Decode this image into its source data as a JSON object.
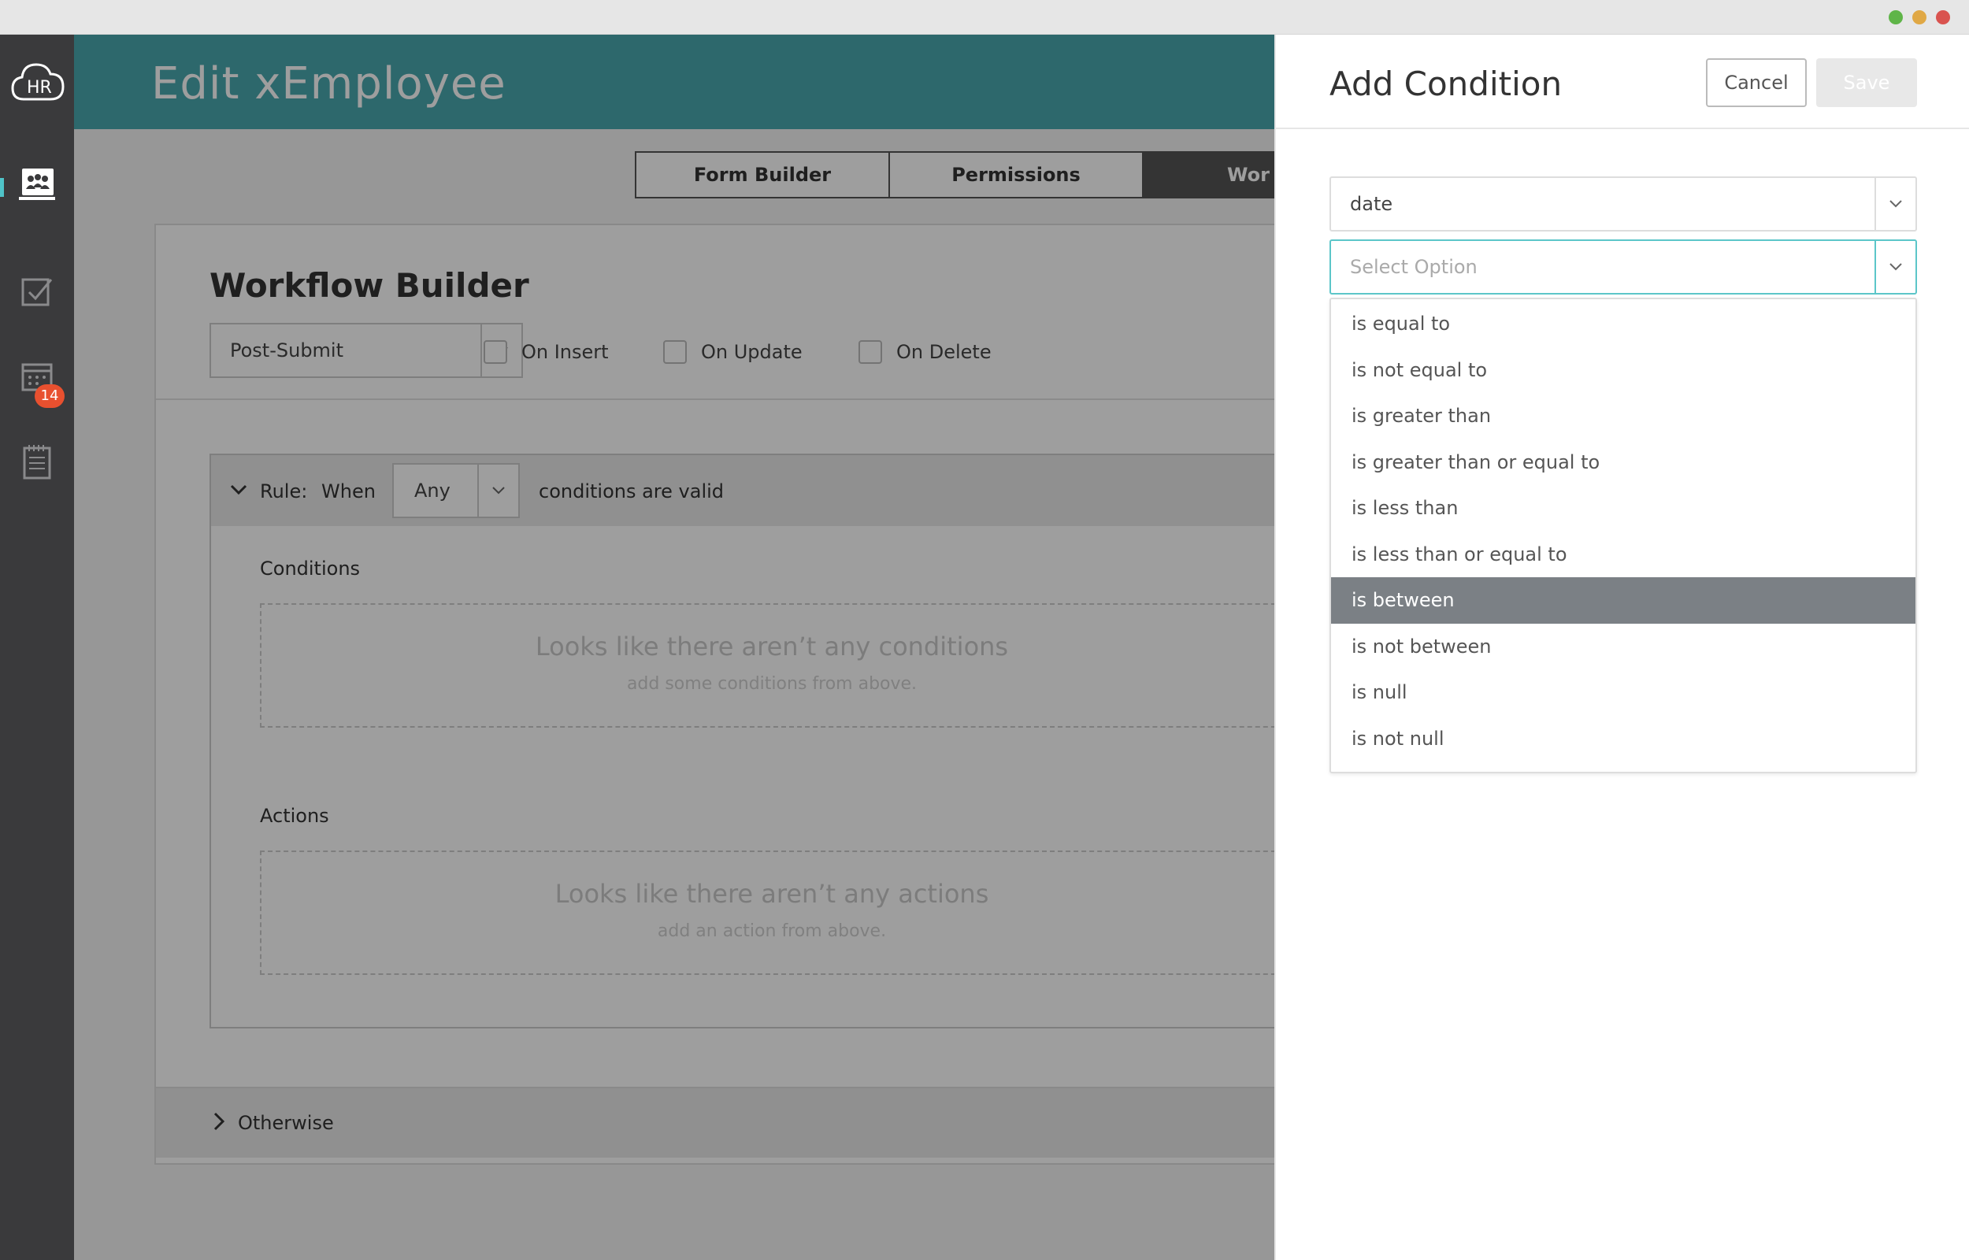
{
  "app": {
    "page_title": "Edit xEmployee",
    "sidebar_badge": "14"
  },
  "tabs": [
    {
      "label": "Form Builder"
    },
    {
      "label": "Permissions"
    },
    {
      "label": "Wor"
    }
  ],
  "workflow": {
    "title": "Workflow Builder",
    "trigger_value": "Post-Submit",
    "checkboxes": [
      {
        "label": "On Insert",
        "checked": false
      },
      {
        "label": "On Update",
        "checked": false
      },
      {
        "label": "On Delete",
        "checked": false
      }
    ],
    "rule": {
      "rule_label": "Rule:",
      "when_label": "When",
      "any_value": "Any",
      "suffix": "conditions are valid",
      "conditions_title": "Conditions",
      "conditions_empty_title": "Looks like there aren’t any conditions",
      "conditions_empty_sub": "add some conditions from above.",
      "actions_title": "Actions",
      "actions_empty_title": "Looks like there aren’t any actions",
      "actions_empty_sub": "add an action from above."
    },
    "otherwise_label": "Otherwise"
  },
  "panel": {
    "title": "Add Condition",
    "cancel_label": "Cancel",
    "save_label": "Save",
    "field_value": "date",
    "operator_placeholder": "Select Option",
    "options": [
      "is equal to",
      "is not equal to",
      "is greater than",
      "is greater than or equal to",
      "is less than",
      "is less than or equal to",
      "is between",
      "is not between",
      "is null",
      "is not null"
    ],
    "highlighted_option": "is between"
  },
  "colors": {
    "header": "#4aa8ae",
    "sidebar": "#3a3a3c",
    "focus": "#5cc6c9",
    "badge": "#e8502f",
    "highlight": "#7b8085"
  }
}
